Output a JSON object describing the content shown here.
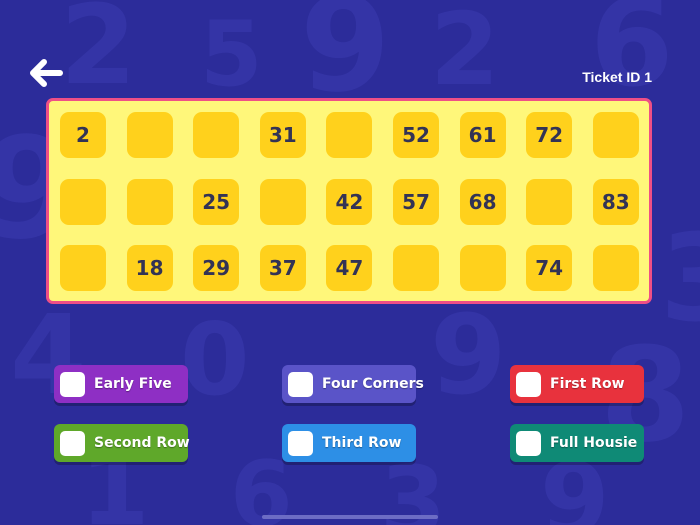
{
  "header": {
    "back_icon": "arrow-left-icon",
    "ticket_label": "Ticket ID 1"
  },
  "ticket": {
    "rows": [
      [
        "2",
        "",
        "",
        "31",
        "",
        "52",
        "61",
        "72",
        ""
      ],
      [
        "",
        "",
        "25",
        "",
        "42",
        "57",
        "68",
        "",
        "83"
      ],
      [
        "",
        "18",
        "29",
        "37",
        "47",
        "",
        "",
        "74",
        ""
      ]
    ]
  },
  "claims": [
    {
      "label": "Early Five",
      "color": "#8e2fc4"
    },
    {
      "label": "Four Corners",
      "color": "#5a54c8"
    },
    {
      "label": "First Row",
      "color": "#e8323d"
    },
    {
      "label": "Second Row",
      "color": "#5fa82a"
    },
    {
      "label": "Third Row",
      "color": "#2d8fe6"
    },
    {
      "label": "Full Housie",
      "color": "#0f8a76"
    }
  ],
  "theme": {
    "background": "#2c2c9a",
    "ticket_bg": "#fff77a",
    "ticket_border": "#ee4f86",
    "cell_bg": "#ffd11c"
  }
}
